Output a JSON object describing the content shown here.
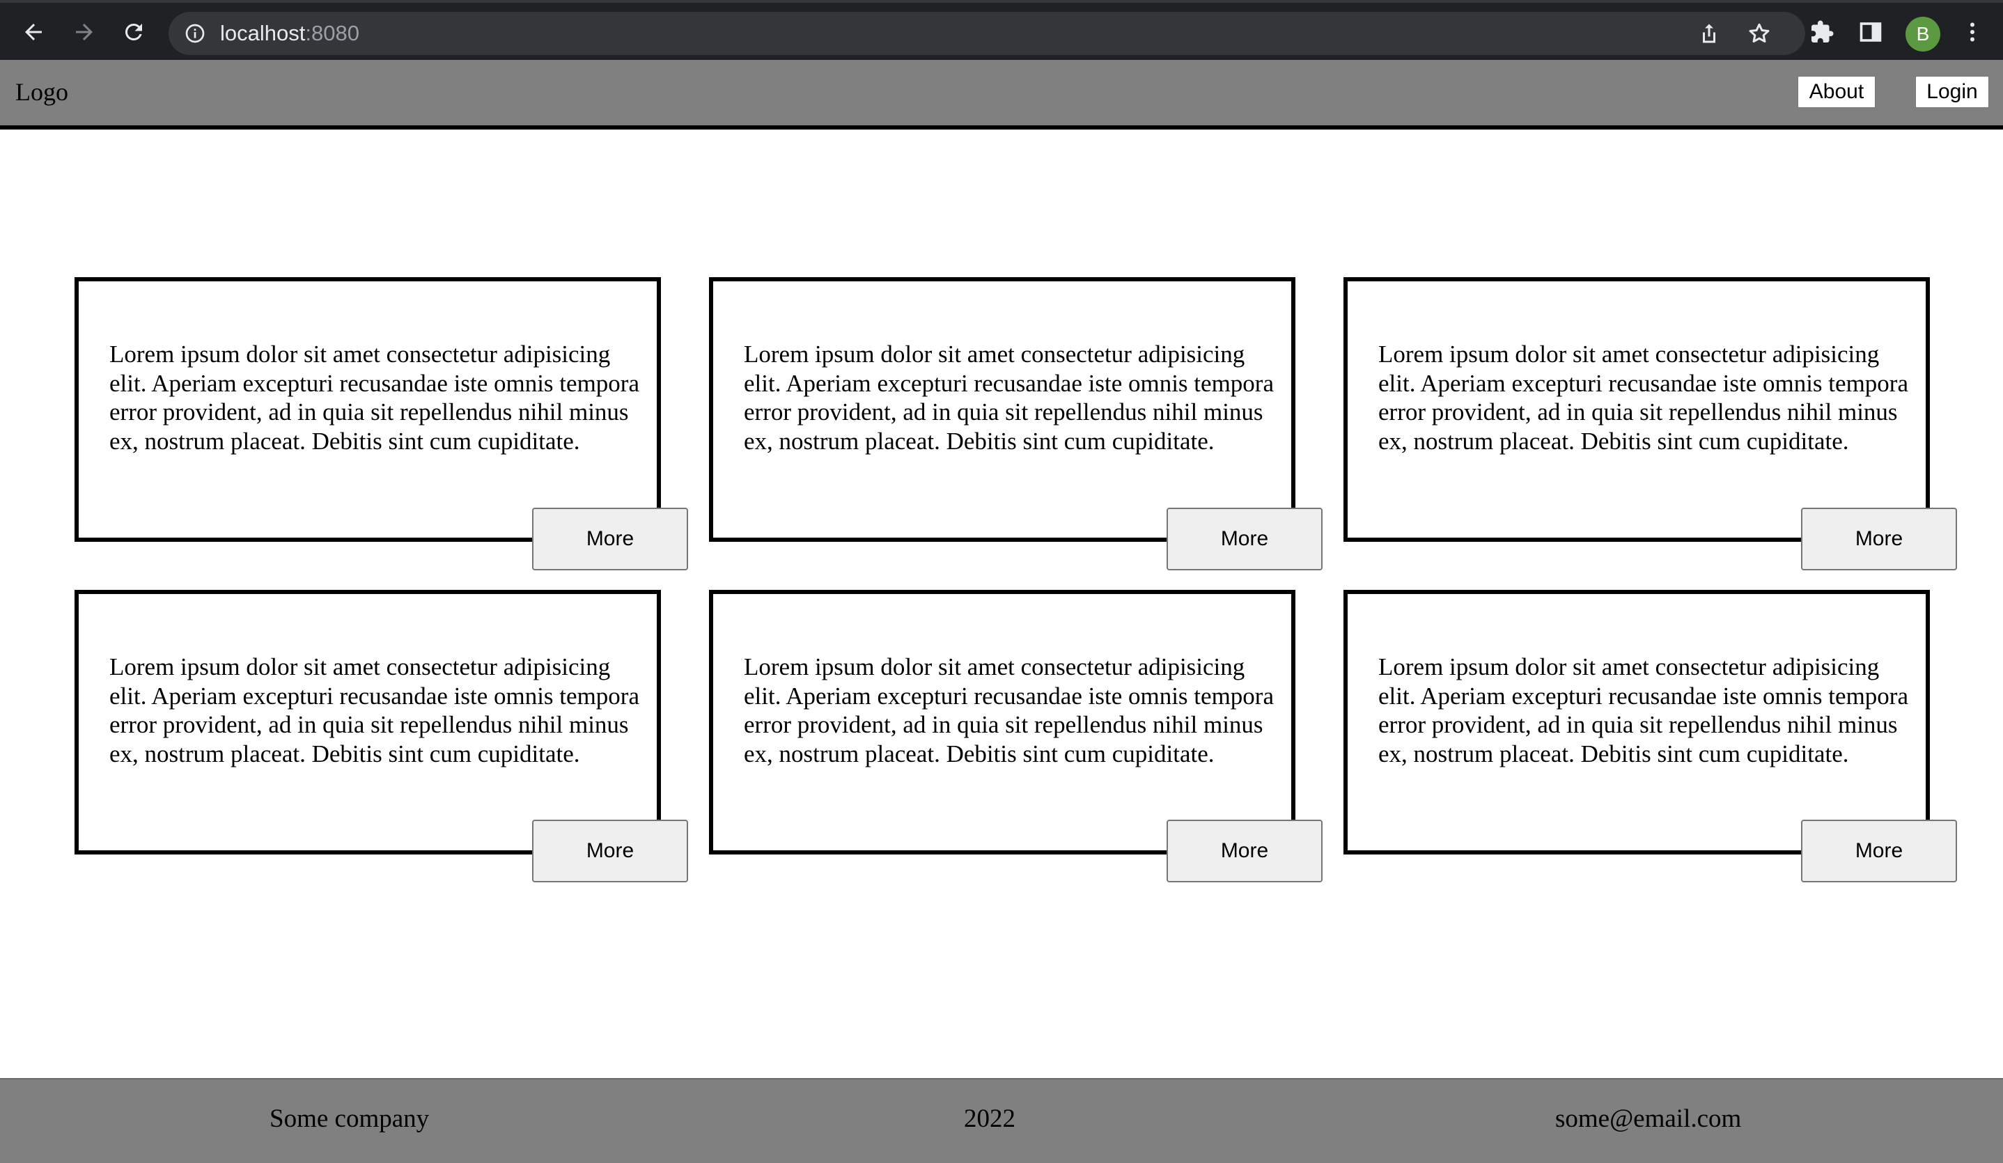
{
  "browser": {
    "url_host": "localhost",
    "url_port": ":8080",
    "profile_initial": "B",
    "icons": [
      "back-arrow-icon",
      "forward-arrow-icon",
      "reload-icon",
      "info-icon",
      "share-icon",
      "bookmark-star-icon",
      "extensions-puzzle-icon",
      "side-panel-icon",
      "kebab-menu-icon"
    ]
  },
  "header": {
    "logo": "Logo",
    "about_label": "About",
    "login_label": "Login"
  },
  "cards": [
    {
      "text": "Lorem ipsum dolor sit amet consectetur adipisicing elit. Aperiam excepturi recusandae iste omnis tempora error provident, ad in quia sit repellendus nihil minus ex, nostrum placeat. Debitis sint cum cupiditate.",
      "button": "More"
    },
    {
      "text": "Lorem ipsum dolor sit amet consectetur adipisicing elit. Aperiam excepturi recusandae iste omnis tempora error provident, ad in quia sit repellendus nihil minus ex, nostrum placeat. Debitis sint cum cupiditate.",
      "button": "More"
    },
    {
      "text": "Lorem ipsum dolor sit amet consectetur adipisicing elit. Aperiam excepturi recusandae iste omnis tempora error provident, ad in quia sit repellendus nihil minus ex, nostrum placeat. Debitis sint cum cupiditate.",
      "button": "More"
    },
    {
      "text": "Lorem ipsum dolor sit amet consectetur adipisicing elit. Aperiam excepturi recusandae iste omnis tempora error provident, ad in quia sit repellendus nihil minus ex, nostrum placeat. Debitis sint cum cupiditate.",
      "button": "More"
    },
    {
      "text": "Lorem ipsum dolor sit amet consectetur adipisicing elit. Aperiam excepturi recusandae iste omnis tempora error provident, ad in quia sit repellendus nihil minus ex, nostrum placeat. Debitis sint cum cupiditate.",
      "button": "More"
    },
    {
      "text": "Lorem ipsum dolor sit amet consectetur adipisicing elit. Aperiam excepturi recusandae iste omnis tempora error provident, ad in quia sit repellendus nihil minus ex, nostrum placeat. Debitis sint cum cupiditate.",
      "button": "More"
    }
  ],
  "footer": {
    "company": "Some company",
    "year": "2022",
    "email": "some@email.com"
  },
  "colors": {
    "browser_bg": "#202124",
    "address_bg": "#35363a",
    "header_bg": "#808080",
    "footer_bg": "#808080",
    "avatar_bg": "#5b9a40",
    "button_bg": "#efefef"
  }
}
